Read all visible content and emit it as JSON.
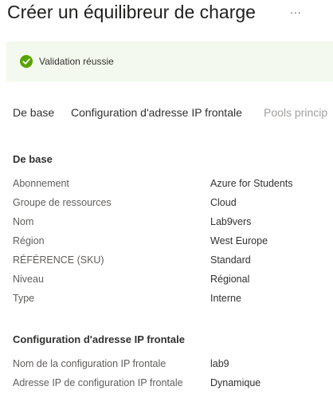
{
  "header": {
    "title": "Créer un équilibreur de charge",
    "more_label": "..."
  },
  "banner": {
    "message": "Validation réussie"
  },
  "tabs": [
    {
      "label": "De base",
      "enabled": true
    },
    {
      "label": "Configuration d'adresse IP frontale",
      "enabled": true
    },
    {
      "label": "Pools princip",
      "enabled": false
    }
  ],
  "sections": [
    {
      "title": "De base",
      "rows": [
        {
          "label": "Abonnement",
          "value": "Azure for Students"
        },
        {
          "label": "Groupe de ressources",
          "value": "Cloud"
        },
        {
          "label": "Nom",
          "value": "Lab9vers"
        },
        {
          "label": "Région",
          "value": "West Europe"
        },
        {
          "label": "RÉFÉRENCE (SKU)",
          "value": "Standard"
        },
        {
          "label": "Niveau",
          "value": "Régional"
        },
        {
          "label": "Type",
          "value": "Interne"
        }
      ]
    },
    {
      "title": "Configuration d'adresse IP frontale",
      "rows": [
        {
          "label": "Nom de la configuration IP frontale",
          "value": "lab9"
        },
        {
          "label": "Adresse IP de configuration IP frontale",
          "value": "Dynamique"
        }
      ]
    }
  ],
  "colors": {
    "success_green": "#57a300",
    "banner_bg": "#f3f9ee",
    "disabled_text": "#a19f9d"
  }
}
